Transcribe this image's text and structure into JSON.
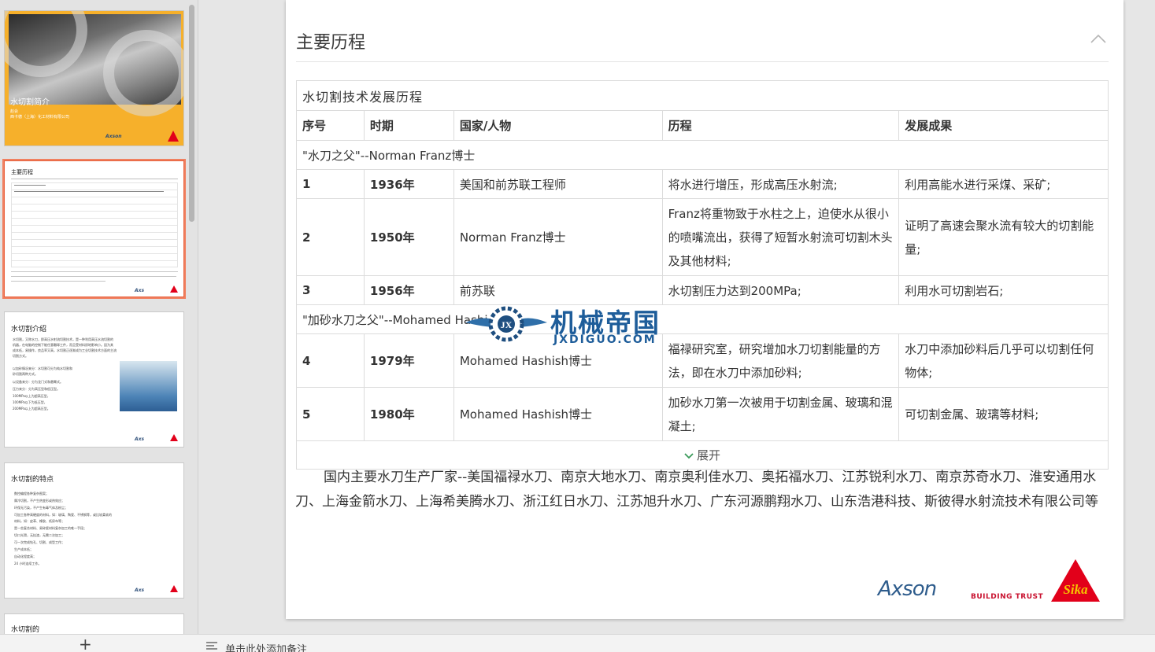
{
  "thumbnails": {
    "slide1": {
      "title": "水切割简介",
      "line1": "赵会",
      "line2": "西卡德（上海）化工材料有限公司",
      "logo_axson": "Axson"
    },
    "slide2": {
      "title": "主要历程"
    },
    "slide3": {
      "title": "水切割介绍",
      "lines": [
        "水切割，又称水刀，即高压水射流切割技术，是一种利用高压水流切割的",
        "机器，在电脑的控制下能任意雕琢工件，而且受材料质地影响小。因为其",
        "成本低，易操作，良品率又高，水切割正逐渐成为工业切割技术方面的主流",
        "切割方式。",
        "以加砂情况来分：水切割可分为纯水切割和",
        "砂切割两种方式。",
        "以设备来分：分为龙门式和悬臂式。",
        "压力来分：分为高压型和低压型。",
        "100MPa以上为超高压型，",
        "100MPa以下为低压型，",
        "200MPa以上为超高压型。"
      ]
    },
    "slide4": {
      "title": "水切割的特点",
      "bullets": [
        "数控编程各种复杂图案；",
        "属冷切割，不产生热变形或热效应；",
        "环保无污染，不产生有毒气体及粉尘；",
        "可加工各种高硬度的材料，如：玻璃、陶瓷、不锈钢等，或比较柔软的",
        "材料，如：皮革、橡胶、纸尿布等；",
        "是一些复合材料、易碎瓷材料复杂加工的唯一手段；",
        "切口光滑，无挂渣，无需二次加工；",
        "可一次完成钻孔、切割、成型工作；",
        "生产成本低；",
        "自动化程度高；",
        "24 小时连续工作。"
      ]
    },
    "slide5": {
      "title": "水切割的"
    }
  },
  "slide": {
    "heading": "主要历程",
    "table": {
      "caption": "水切割技术发展历程",
      "headers": [
        "序号",
        "时期",
        "国家/人物",
        "历程",
        "发展成果"
      ],
      "section1": "\"水刀之父\"--Norman Franz博士",
      "section2": "\"加砂水刀之父\"--Mohamed Hashi",
      "rows": [
        {
          "no": "1",
          "year": "1936年",
          "who": "美国和前苏联工程师",
          "history": "将水进行增压，形成高压水射流;",
          "result": "利用高能水进行采煤、采矿;"
        },
        {
          "no": "2",
          "year": "1950年",
          "who": "Norman Franz博士",
          "history": "Franz将重物致于水柱之上，迫使水从很小的喷嘴流出，获得了短暂水射流可切割木头及其他材料;",
          "result": "证明了高速会聚水流有较大的切割能量;"
        },
        {
          "no": "3",
          "year": "1956年",
          "who": "前苏联",
          "history": "水切割压力达到200MPa;",
          "result": "利用水可切割岩石;"
        },
        {
          "no": "4",
          "year": "1979年",
          "who": "Mohamed Hashish博士",
          "history": "福禄研究室，研究增加水刀切割能量的方法，即在水刀中添加砂料;",
          "result": "水刀中添加砂料后几乎可以切割任何物体;"
        },
        {
          "no": "5",
          "year": "1980年",
          "who": "Mohamed Hashish博士",
          "history": "加砂水刀第一次被用于切割金属、玻璃和混凝土;",
          "result": "可切割金属、玻璃等材料;"
        }
      ],
      "expand_label": "展开"
    },
    "paragraph": "国内主要水刀生产厂家--美国福禄水刀、南京大地水刀、南京奥利佳水刀、奥拓福水刀、江苏锐利水刀、南京苏奇水刀、淮安通用水刀、上海金箭水刀、上海希美腾水刀、浙江红日水刀、江苏旭升水刀、广东河源鹏翔水刀、山东浩港科技、斯彼得水射流技术有限公司等",
    "logos": {
      "axson": "Axson",
      "trust": "BUILDING TRUST"
    }
  },
  "watermark": {
    "cn": "机械帝国",
    "en": "JXDIGUO.COM"
  },
  "bottom": {
    "add_slide": "+",
    "notes_placeholder": "单击此处添加备注"
  },
  "colors": {
    "accent_orange": "#f6b02b",
    "selection": "#e8603c",
    "sika_red": "#e2001a",
    "axson_blue": "#2e5c8c"
  }
}
